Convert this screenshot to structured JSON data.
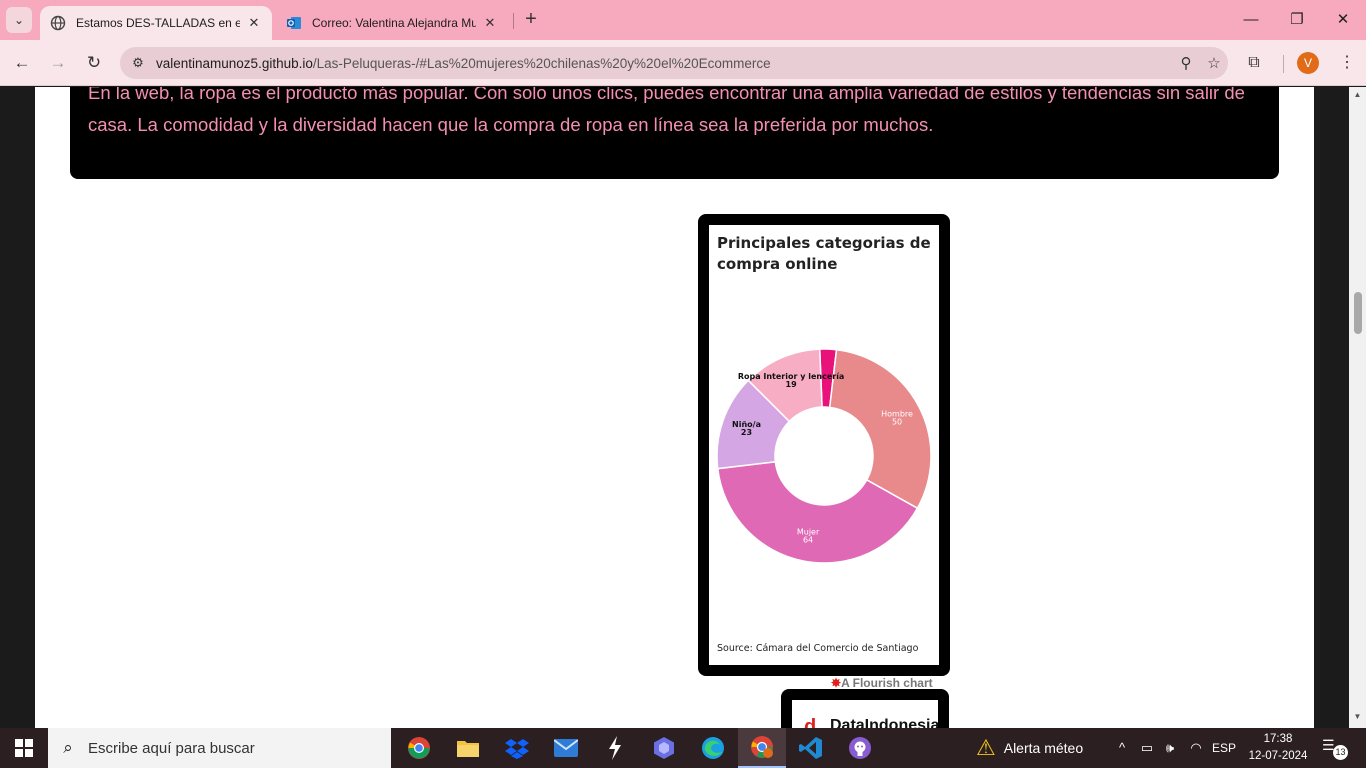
{
  "browser": {
    "tabs": [
      {
        "title": "Estamos DES-TALLADAS en el E",
        "active": true
      },
      {
        "title": "Correo: Valentina Alejandra Mu",
        "active": false
      }
    ],
    "new_tab": "+",
    "window_controls": {
      "minimize": "—",
      "maximize": "❐",
      "close": "✕"
    },
    "url_domain": "valentinamunoz5.github.io",
    "url_path": "/Las-Peluqueras-/#Las%20mujeres%20chilenas%20y%20el%20Ecommerce",
    "profile_initial": "V",
    "accent_color": "#f7a9bd"
  },
  "page": {
    "paragraph": "En la web, la ropa es el producto más popular. Con solo unos clics, puedes encontrar una amplia variedad de estilos y tendencias sin salir de casa. La comodidad y la diversidad hacen que la compra de ropa en línea sea la preferida por muchos.",
    "chart_title": "Principales categorias de compra online",
    "chart_source": "Source: Cámara del Comercio de Santiago",
    "flourish_credit": "A Flourish chart",
    "next_embed_text": "DataIndonesia"
  },
  "chart_data": {
    "type": "pie",
    "variant": "donut",
    "title": "Principales categorias de compra online",
    "source": "Source: Cámara del Comercio de Santiago",
    "slices": [
      {
        "label": "",
        "value": 4,
        "color": "#e8127a"
      },
      {
        "label": "Hombre",
        "value": 50,
        "color": "#e8898c"
      },
      {
        "label": "Mujer",
        "value": 64,
        "color": "#e069b5"
      },
      {
        "label": "Niño/a",
        "value": 23,
        "color": "#d4a6e4"
      },
      {
        "label": "Ropa Interior y lencería",
        "value": 19,
        "color": "#f7adc3"
      }
    ]
  },
  "taskbar": {
    "search_placeholder": "Escribe aquí para buscar",
    "weather": "Alerta méteo",
    "language": "ESP",
    "time": "17:38",
    "date": "12-07-2024",
    "notifications": "13"
  }
}
